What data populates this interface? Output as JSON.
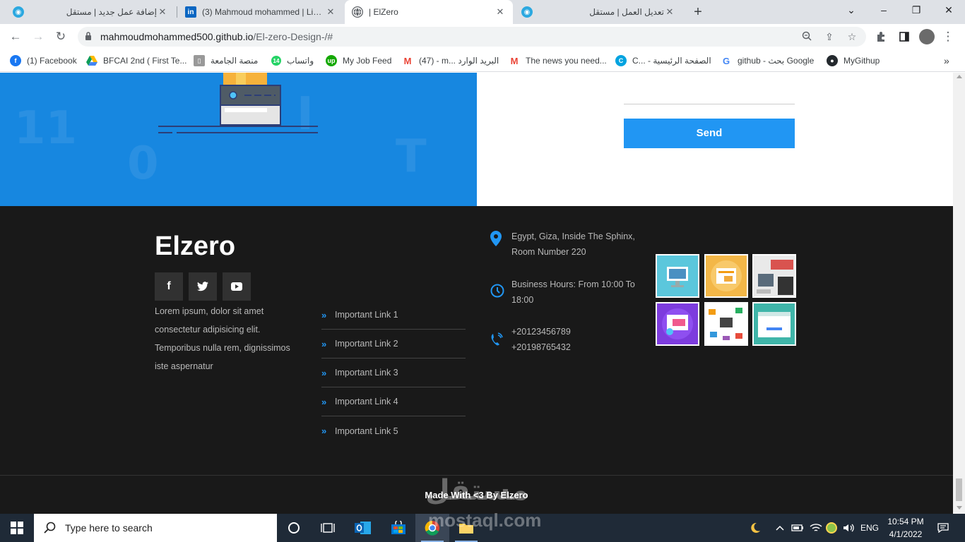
{
  "browser": {
    "tabs": [
      {
        "title": "إضافة عمل جديد | مستقل",
        "active": false
      },
      {
        "title": "(3) Mahmoud mohammed | LinkedIn",
        "active": false
      },
      {
        "title": "| ElZero",
        "active": true
      },
      {
        "title": "تعديل العمل | مستقل",
        "active": false
      }
    ],
    "address": {
      "host": "mahmoudmohammed500.github.io",
      "path": "/El-zero-Design-/#"
    },
    "bookmarks": [
      {
        "label": "(1) Facebook",
        "icon": "facebook-icon",
        "color": "#1877f2"
      },
      {
        "label": "BFCAI 2nd ( First Te...",
        "icon": "google-drive-icon",
        "color": "#34a853"
      },
      {
        "label": "منصة الجامعة",
        "icon": "university-icon",
        "color": "#888888"
      },
      {
        "label": "واتساب",
        "icon": "whatsapp-icon",
        "color": "#25d366"
      },
      {
        "label": "My Job Feed",
        "icon": "upwork-icon",
        "color": "#14a800"
      },
      {
        "label": "(47) - m... البريد الوارد",
        "icon": "gmail-icon",
        "color": "#ea4335"
      },
      {
        "label": "The news you need...",
        "icon": "gmail-icon",
        "color": "#ea4335"
      },
      {
        "label": "C... - الصفحة الرئيسية",
        "icon": "canva-icon",
        "color": "#00c4cc"
      },
      {
        "label": "github - بحث Google",
        "icon": "google-icon",
        "color": "#4285f4"
      },
      {
        "label": "MyGithup",
        "icon": "github-icon",
        "color": "#24292e"
      }
    ]
  },
  "page": {
    "send_label": "Send",
    "footer": {
      "brand": "Elzero",
      "about": "Lorem ipsum, dolor sit amet consectetur adipisicing elit. Temporibus nulla rem, dignissimos iste aspernatur",
      "links": [
        "Important Link 1",
        "Important Link 2",
        "Important Link 3",
        "Important Link 4",
        "Important Link 5"
      ],
      "address": [
        "Egypt, Giza, Inside The Sphinx,",
        "Room Number 220"
      ],
      "hours": [
        "Business Hours: From 10:00 To",
        "18:00"
      ],
      "phones": [
        "+20123456789",
        "+20198765432"
      ],
      "copyright": "Made With <3 By Elzero"
    }
  },
  "watermark": {
    "arabic": "مستقل",
    "latin": "mostaql.com"
  },
  "taskbar": {
    "search_placeholder": "Type here to search",
    "language": "ENG",
    "time": "10:54 PM",
    "date": "4/1/2022"
  },
  "colors": {
    "accent": "#2196f3",
    "hero_blue": "#1787e0",
    "footer_bg": "#191919"
  }
}
